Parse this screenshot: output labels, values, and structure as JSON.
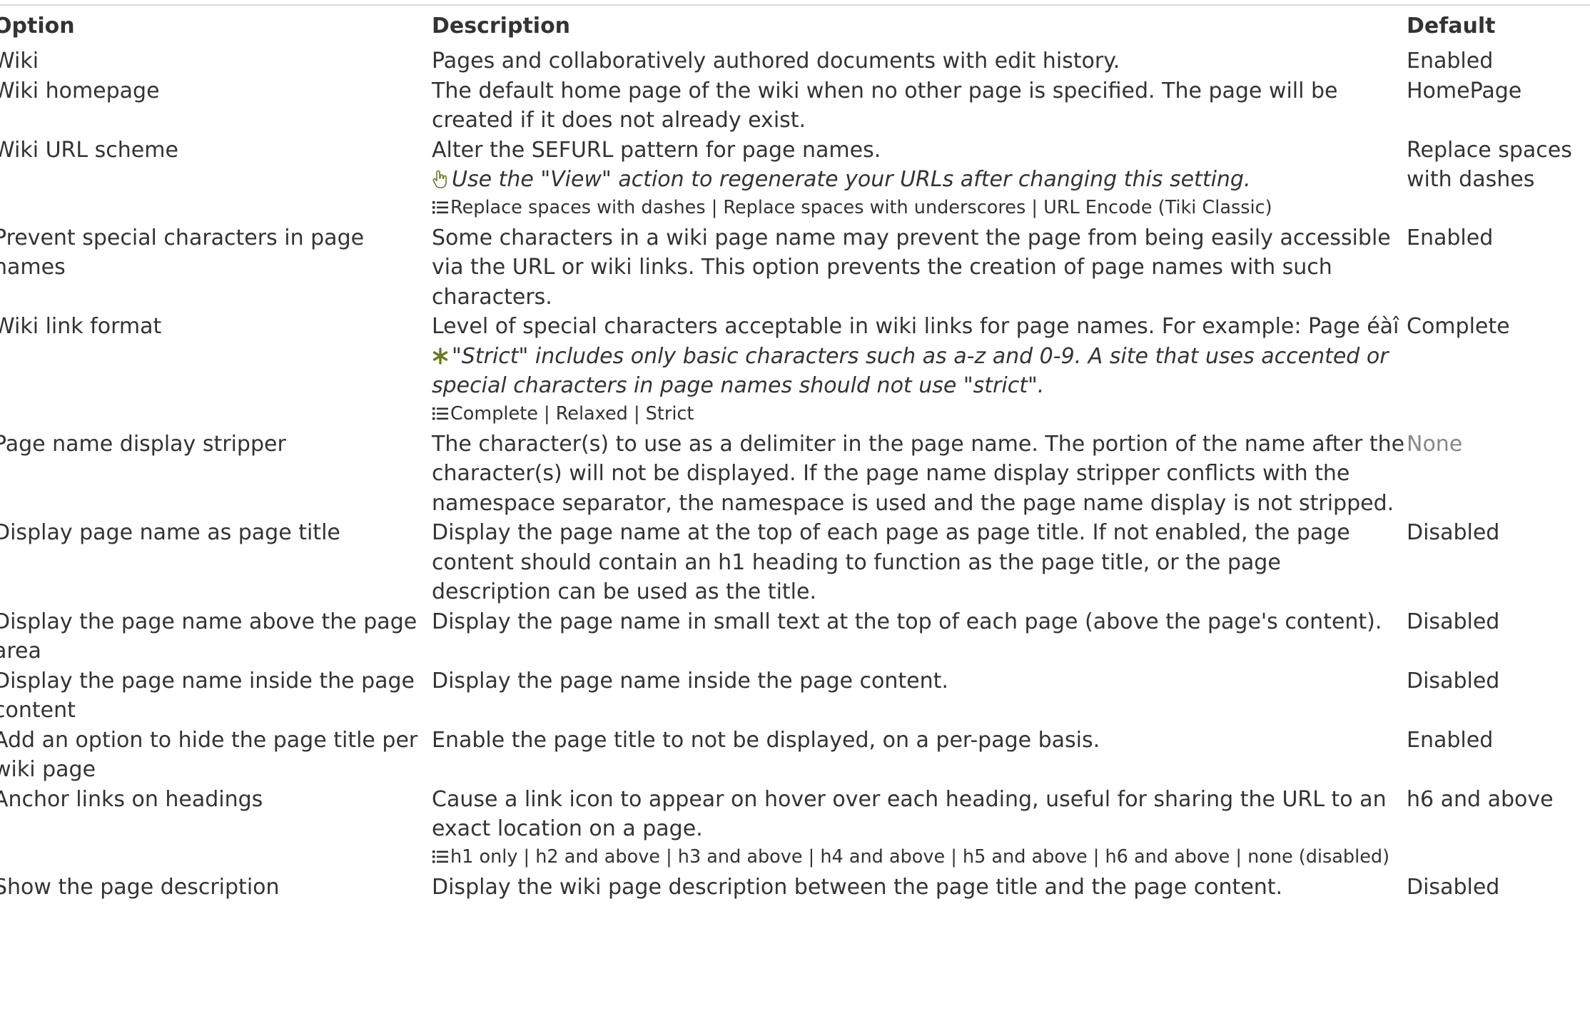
{
  "header": {
    "option": "Option",
    "description": "Description",
    "default": "Default"
  },
  "rows": [
    {
      "option": "Wiki",
      "description": "Pages and collaboratively authored documents with edit history.",
      "hint": "",
      "choices": "",
      "default": "Enabled"
    },
    {
      "option": "Wiki homepage",
      "description": "The default home page of the wiki when no other page is specified. The page will be created if it does not already exist.",
      "hint": "",
      "choices": "",
      "default": "HomePage"
    },
    {
      "option": "Wiki URL scheme",
      "description": "Alter the SEFURL pattern for page names.",
      "hint": "Use the \"View\" action to regenerate your URLs after changing this setting.",
      "hint_icon": "hand-pointer-icon",
      "choices": "Replace spaces with dashes | Replace spaces with underscores | URL Encode (Tiki Classic)",
      "default": "Replace spaces with dashes"
    },
    {
      "option": "Prevent special characters in page names",
      "description": "Some characters in a wiki page name may prevent the page from being easily accessible via the URL or wiki links. This option prevents the creation of page names with such characters.",
      "hint": "",
      "choices": "",
      "default": "Enabled"
    },
    {
      "option": "Wiki link format",
      "description": "Level of special characters acceptable in wiki links for page names. For example: Page éàî",
      "hint": "\"Strict\" includes only basic characters such as a-z and 0-9. A site that uses accented or special characters in page names should not use \"strict\".",
      "hint_icon": "asterisk-icon",
      "choices": "Complete | Relaxed | Strict",
      "default": "Complete"
    },
    {
      "option": "Page name display stripper",
      "description": "The character(s) to use as a delimiter in the page name. The portion of the name after the character(s) will not be displayed. If the page name display stripper conflicts with the namespace separator, the namespace is used and the page name display is not stripped.",
      "hint": "",
      "choices": "",
      "default": "None",
      "default_muted": true
    },
    {
      "option": "Display page name as page title",
      "description": "Display the page name at the top of each page as page title. If not enabled, the page content should contain an h1 heading to function as the page title, or the page description can be used as the title.",
      "hint": "",
      "choices": "",
      "default": "Disabled"
    },
    {
      "option": "Display the page name above the page area",
      "description": "Display the page name in small text at the top of each page (above the page's content).",
      "hint": "",
      "choices": "",
      "default": "Disabled"
    },
    {
      "option": "Display the page name inside the page content",
      "description": "Display the page name inside the page content.",
      "hint": "",
      "choices": "",
      "default": "Disabled"
    },
    {
      "option": "Add an option to hide the page title per wiki page",
      "description": "Enable the page title to not be displayed, on a per-page basis.",
      "hint": "",
      "choices": "",
      "default": "Enabled"
    },
    {
      "option": "Anchor links on headings",
      "description": "Cause a link icon to appear on hover over each heading, useful for sharing the URL to an exact location on a page.",
      "hint": "",
      "choices": "h1 only | h2 and above | h3 and above | h4 and above | h5 and above | h6 and above | none (disabled)",
      "default": "h6 and above"
    },
    {
      "option": "Show the page description",
      "description": "Display the wiki page description between the page title and the page content.",
      "hint": "",
      "choices": "",
      "default": "Disabled"
    }
  ],
  "colors": {
    "text": "#333333",
    "muted": "#888888",
    "hint_icon": "#6b7a1e",
    "rule": "#d9d9d9"
  }
}
